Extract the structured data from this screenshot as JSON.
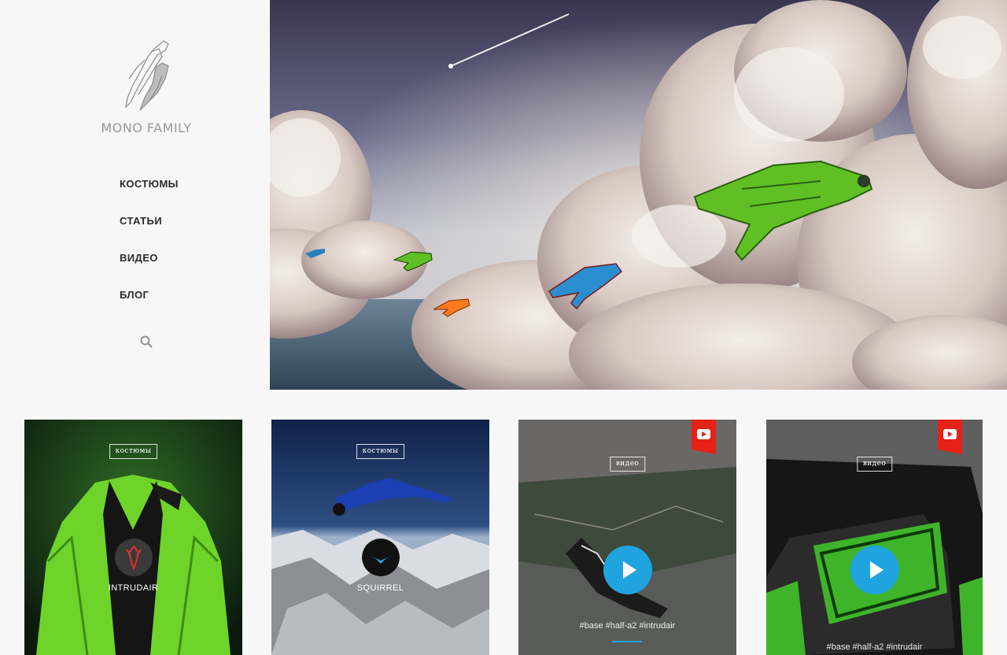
{
  "brand": {
    "name": "MONO FAMILY"
  },
  "nav": {
    "items": [
      {
        "label": "КОСТЮМЫ"
      },
      {
        "label": "СТАТЬИ"
      },
      {
        "label": "ВИДЕО"
      },
      {
        "label": "БЛОГ"
      }
    ],
    "search_icon": "search-icon"
  },
  "colors": {
    "accent": "#1fa4e0",
    "youtube_red": "#e62117",
    "suit_green": "#6ed42a",
    "text_dark": "#2a2a2a",
    "brand_gray": "#9a9a9a"
  },
  "cards": [
    {
      "tag": "костюмы",
      "label": "INTRUDAIR",
      "icon": "intrudair-logo-icon"
    },
    {
      "tag": "костюмы",
      "label": "SQUIRREL",
      "icon": "squirrel-logo-icon"
    },
    {
      "tag": "видео",
      "hashtags": "#base #half-a2 #intrudair",
      "icon": "youtube-icon"
    },
    {
      "tag": "видео",
      "hashtags": "#base #half-a2 #intrudair",
      "icon": "youtube-icon"
    }
  ]
}
